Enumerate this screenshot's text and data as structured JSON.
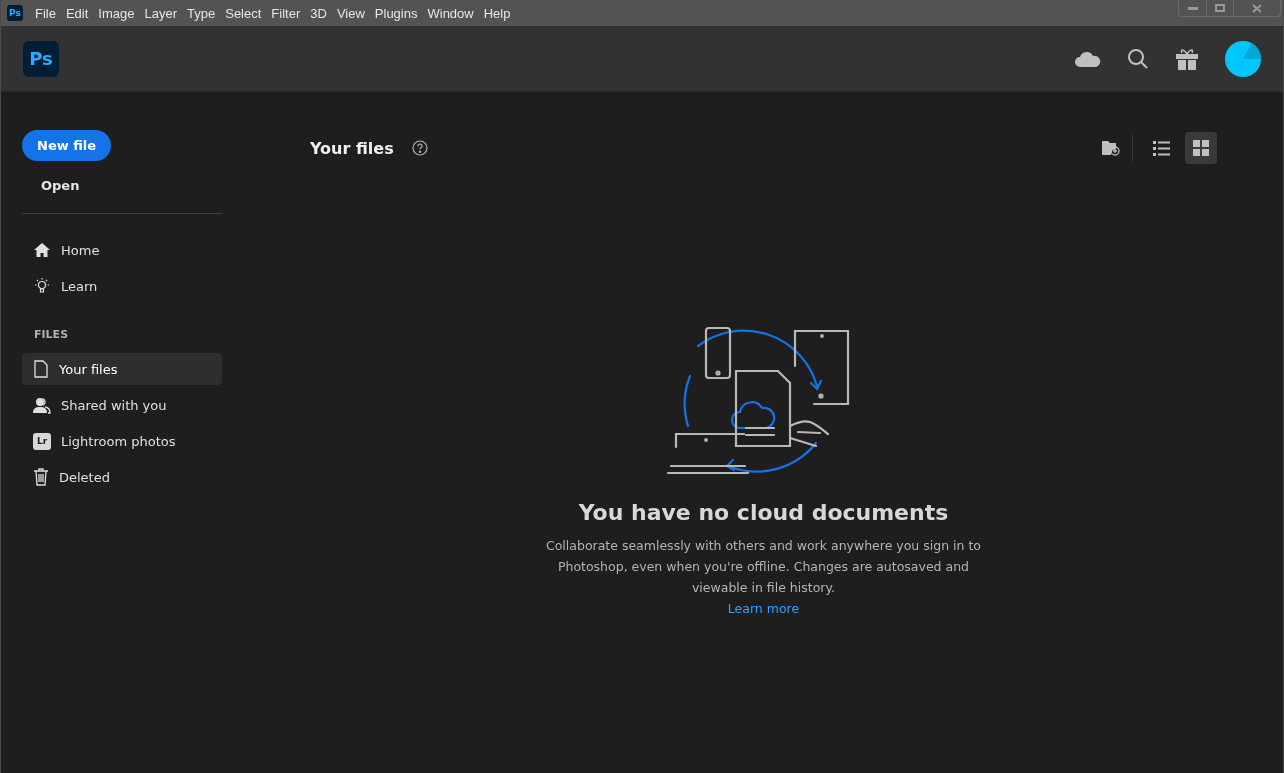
{
  "app_icon": {
    "label": "Ps"
  },
  "menu": [
    "File",
    "Edit",
    "Image",
    "Layer",
    "Type",
    "Select",
    "Filter",
    "3D",
    "View",
    "Plugins",
    "Window",
    "Help"
  ],
  "header": {
    "logo": "Ps"
  },
  "sidebar": {
    "new_file": "New file",
    "open": "Open",
    "nav": [
      {
        "label": "Home",
        "selected": false
      },
      {
        "label": "Learn",
        "selected": false
      }
    ],
    "section": "FILES",
    "files": [
      {
        "label": "Your files",
        "selected": true
      },
      {
        "label": "Shared with you",
        "selected": false
      },
      {
        "label": "Lightroom photos",
        "selected": false,
        "badge": "Lr"
      },
      {
        "label": "Deleted",
        "selected": false
      }
    ]
  },
  "content": {
    "title": "Your files",
    "views": [
      {
        "selected": false
      },
      {
        "selected": true
      }
    ],
    "empty": {
      "heading": "You have no cloud documents",
      "body": "Collaborate seamlessly with others and work anywhere you sign in to Photoshop, even when you're offline. Changes are autosaved and viewable in file history.",
      "link": "Learn more"
    }
  }
}
